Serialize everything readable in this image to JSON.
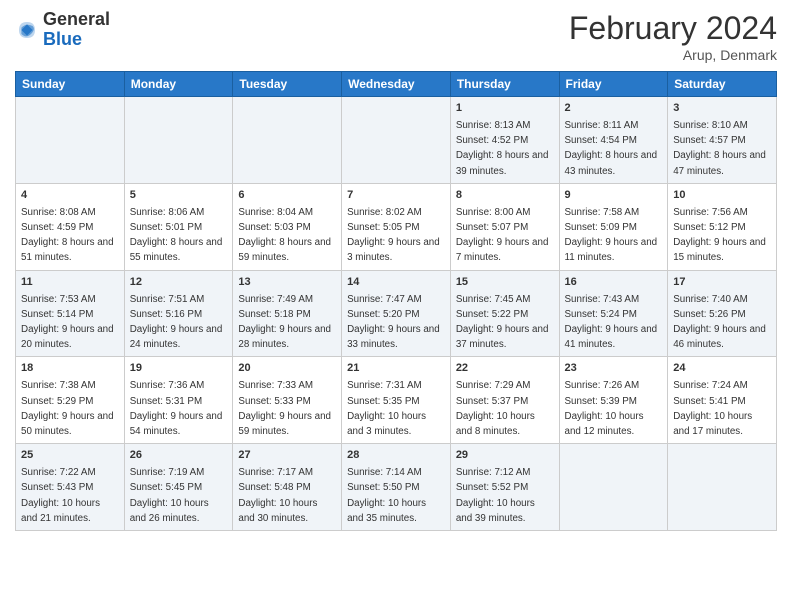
{
  "header": {
    "logo_general": "General",
    "logo_blue": "Blue",
    "month_title": "February 2024",
    "subtitle": "Arup, Denmark"
  },
  "weekdays": [
    "Sunday",
    "Monday",
    "Tuesday",
    "Wednesday",
    "Thursday",
    "Friday",
    "Saturday"
  ],
  "weeks": [
    [
      {
        "day": "",
        "info": ""
      },
      {
        "day": "",
        "info": ""
      },
      {
        "day": "",
        "info": ""
      },
      {
        "day": "",
        "info": ""
      },
      {
        "day": "1",
        "info": "Sunrise: 8:13 AM\nSunset: 4:52 PM\nDaylight: 8 hours and 39 minutes."
      },
      {
        "day": "2",
        "info": "Sunrise: 8:11 AM\nSunset: 4:54 PM\nDaylight: 8 hours and 43 minutes."
      },
      {
        "day": "3",
        "info": "Sunrise: 8:10 AM\nSunset: 4:57 PM\nDaylight: 8 hours and 47 minutes."
      }
    ],
    [
      {
        "day": "4",
        "info": "Sunrise: 8:08 AM\nSunset: 4:59 PM\nDaylight: 8 hours and 51 minutes."
      },
      {
        "day": "5",
        "info": "Sunrise: 8:06 AM\nSunset: 5:01 PM\nDaylight: 8 hours and 55 minutes."
      },
      {
        "day": "6",
        "info": "Sunrise: 8:04 AM\nSunset: 5:03 PM\nDaylight: 8 hours and 59 minutes."
      },
      {
        "day": "7",
        "info": "Sunrise: 8:02 AM\nSunset: 5:05 PM\nDaylight: 9 hours and 3 minutes."
      },
      {
        "day": "8",
        "info": "Sunrise: 8:00 AM\nSunset: 5:07 PM\nDaylight: 9 hours and 7 minutes."
      },
      {
        "day": "9",
        "info": "Sunrise: 7:58 AM\nSunset: 5:09 PM\nDaylight: 9 hours and 11 minutes."
      },
      {
        "day": "10",
        "info": "Sunrise: 7:56 AM\nSunset: 5:12 PM\nDaylight: 9 hours and 15 minutes."
      }
    ],
    [
      {
        "day": "11",
        "info": "Sunrise: 7:53 AM\nSunset: 5:14 PM\nDaylight: 9 hours and 20 minutes."
      },
      {
        "day": "12",
        "info": "Sunrise: 7:51 AM\nSunset: 5:16 PM\nDaylight: 9 hours and 24 minutes."
      },
      {
        "day": "13",
        "info": "Sunrise: 7:49 AM\nSunset: 5:18 PM\nDaylight: 9 hours and 28 minutes."
      },
      {
        "day": "14",
        "info": "Sunrise: 7:47 AM\nSunset: 5:20 PM\nDaylight: 9 hours and 33 minutes."
      },
      {
        "day": "15",
        "info": "Sunrise: 7:45 AM\nSunset: 5:22 PM\nDaylight: 9 hours and 37 minutes."
      },
      {
        "day": "16",
        "info": "Sunrise: 7:43 AM\nSunset: 5:24 PM\nDaylight: 9 hours and 41 minutes."
      },
      {
        "day": "17",
        "info": "Sunrise: 7:40 AM\nSunset: 5:26 PM\nDaylight: 9 hours and 46 minutes."
      }
    ],
    [
      {
        "day": "18",
        "info": "Sunrise: 7:38 AM\nSunset: 5:29 PM\nDaylight: 9 hours and 50 minutes."
      },
      {
        "day": "19",
        "info": "Sunrise: 7:36 AM\nSunset: 5:31 PM\nDaylight: 9 hours and 54 minutes."
      },
      {
        "day": "20",
        "info": "Sunrise: 7:33 AM\nSunset: 5:33 PM\nDaylight: 9 hours and 59 minutes."
      },
      {
        "day": "21",
        "info": "Sunrise: 7:31 AM\nSunset: 5:35 PM\nDaylight: 10 hours and 3 minutes."
      },
      {
        "day": "22",
        "info": "Sunrise: 7:29 AM\nSunset: 5:37 PM\nDaylight: 10 hours and 8 minutes."
      },
      {
        "day": "23",
        "info": "Sunrise: 7:26 AM\nSunset: 5:39 PM\nDaylight: 10 hours and 12 minutes."
      },
      {
        "day": "24",
        "info": "Sunrise: 7:24 AM\nSunset: 5:41 PM\nDaylight: 10 hours and 17 minutes."
      }
    ],
    [
      {
        "day": "25",
        "info": "Sunrise: 7:22 AM\nSunset: 5:43 PM\nDaylight: 10 hours and 21 minutes."
      },
      {
        "day": "26",
        "info": "Sunrise: 7:19 AM\nSunset: 5:45 PM\nDaylight: 10 hours and 26 minutes."
      },
      {
        "day": "27",
        "info": "Sunrise: 7:17 AM\nSunset: 5:48 PM\nDaylight: 10 hours and 30 minutes."
      },
      {
        "day": "28",
        "info": "Sunrise: 7:14 AM\nSunset: 5:50 PM\nDaylight: 10 hours and 35 minutes."
      },
      {
        "day": "29",
        "info": "Sunrise: 7:12 AM\nSunset: 5:52 PM\nDaylight: 10 hours and 39 minutes."
      },
      {
        "day": "",
        "info": ""
      },
      {
        "day": "",
        "info": ""
      }
    ]
  ]
}
